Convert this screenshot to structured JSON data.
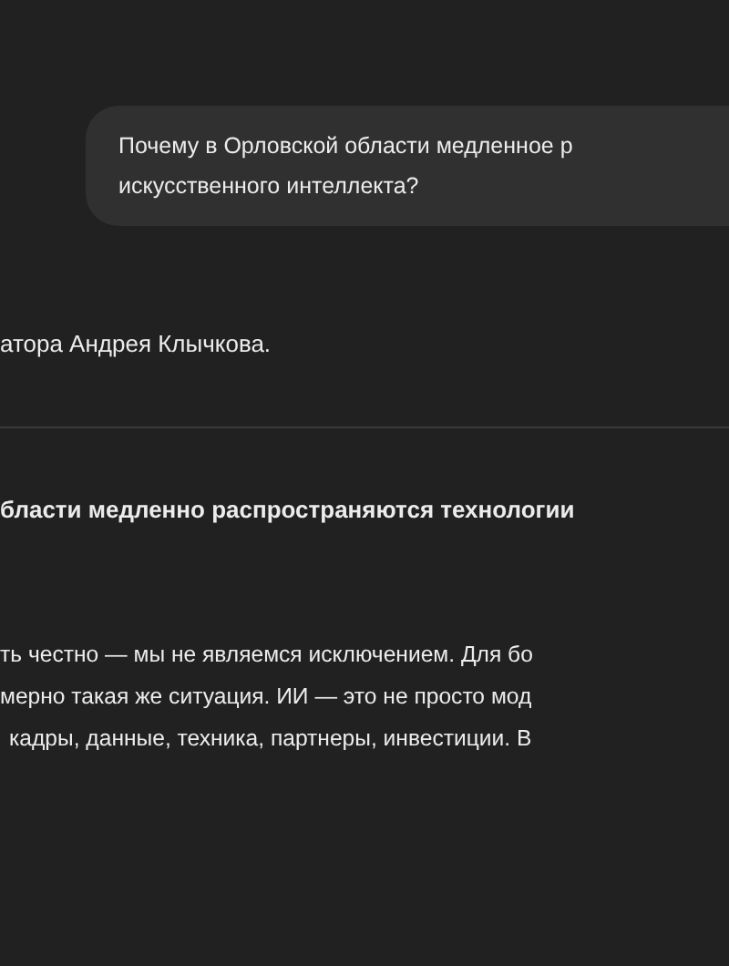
{
  "user_message": {
    "lines": [
      "Почему в Орловской области медленное р",
      "искусственного интеллекта?"
    ]
  },
  "reply_fragment": "атора Андрея Клычкова.",
  "answer": {
    "heading": "бласти медленно распространяются технологии",
    "lines": [
      "ть честно — мы не являемся исключением. Для бо",
      "мерно такая же ситуация. ИИ — это не просто мод",
      "кадры, данные, техника, партнеры, инвестиции. В"
    ]
  }
}
